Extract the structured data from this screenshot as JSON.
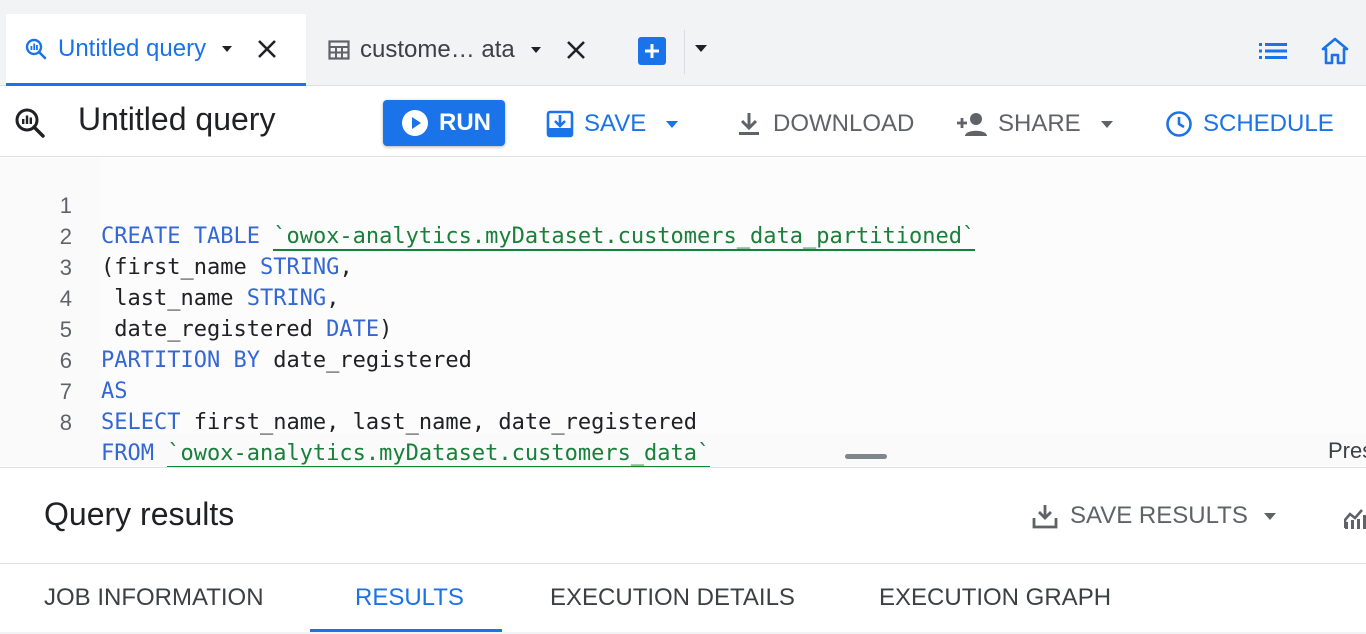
{
  "tabs": {
    "active": {
      "label": "Untitled query",
      "icon": "query-icon"
    },
    "inactive": {
      "label": "custome… ata",
      "icon": "table-icon"
    }
  },
  "toolbar": {
    "title": "Untitled query",
    "run_label": "RUN",
    "save_label": "SAVE",
    "download_label": "DOWNLOAD",
    "share_label": "SHARE",
    "schedule_label": "SCHEDULE"
  },
  "editor": {
    "line_numbers": [
      "1",
      "2",
      "3",
      "4",
      "5",
      "6",
      "7",
      "8"
    ],
    "lines": [
      {
        "kw": "CREATE TABLE",
        "str": "`owox-analytics.myDataset.customers_data_partitioned`"
      },
      {
        "pre": "(first_name ",
        "kw": "STRING",
        "post": ","
      },
      {
        "pre": " last_name ",
        "kw": "STRING",
        "post": ","
      },
      {
        "pre": " date_registered ",
        "kw": "DATE",
        "post": ")"
      },
      {
        "kw": "PARTITION BY",
        "post": " date_registered"
      },
      {
        "kw": "AS"
      },
      {
        "kw": "SELECT",
        "post": " first_name, last_name, date_registered"
      },
      {
        "kw": "FROM",
        "str": "`owox-analytics.myDataset.customers_data`"
      }
    ],
    "overflow_text": "Pres"
  },
  "results": {
    "title": "Query results",
    "save_results_label": "SAVE RESULTS",
    "tabs": [
      "JOB INFORMATION",
      "RESULTS",
      "EXECUTION DETAILS",
      "EXECUTION GRAPH"
    ],
    "active_tab": "RESULTS"
  },
  "colors": {
    "accent": "#1a73e8",
    "keyword": "#3367d6",
    "string": "#188038"
  }
}
